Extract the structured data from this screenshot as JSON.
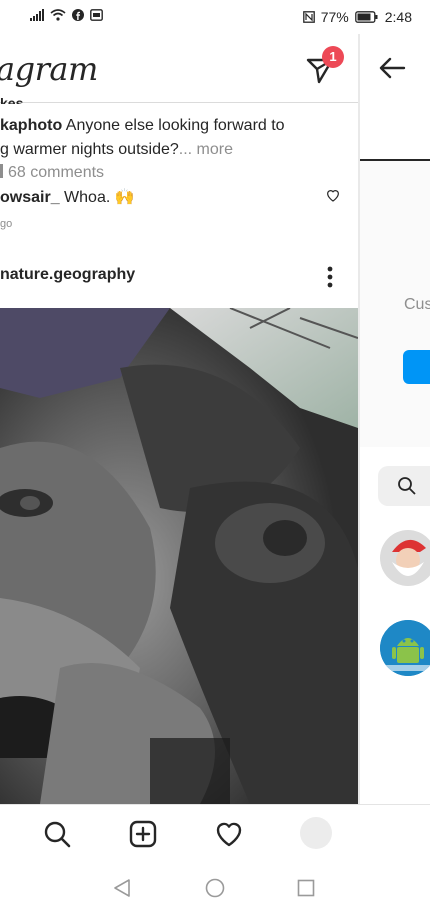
{
  "status_bar": {
    "battery": "77%",
    "time": "2:48"
  },
  "feed": {
    "logo": "agram",
    "dm_badge": "1",
    "cut_line": "kes",
    "caption_user": "kaphoto",
    "caption_text": " Anyone else looking forward to",
    "caption_line2": "g warmer nights outside?",
    "more": "... more",
    "comments": "68 comments",
    "comment_user": "owsair_",
    "comment_text": " Whoa. 🙌",
    "time": "go",
    "post_user": "nature.geography"
  },
  "right_pane": {
    "partial_text": "Cus"
  },
  "bottom_nav": {
    "icons": [
      "search-icon",
      "add-post-icon",
      "heart-icon",
      "profile-avatar"
    ]
  },
  "android_nav": {
    "icons": [
      "back-triangle-icon",
      "home-circle-icon",
      "recents-square-icon"
    ]
  }
}
